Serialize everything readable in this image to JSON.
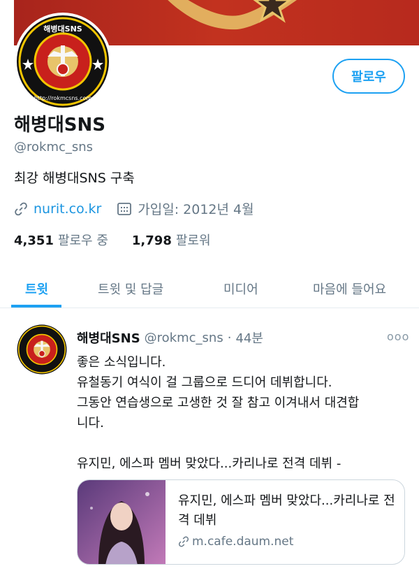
{
  "profile": {
    "name": "해병대SNS",
    "handle": "@rokmc_sns",
    "bio": "최강 해병대SNS 구축",
    "link": "nurit.co.kr",
    "joined": "가입일: 2012년 4월",
    "following_count": "4,351",
    "following_label": "팔로우 중",
    "followers_count": "1,798",
    "followers_label": "팔로워",
    "follow_button": "팔로우",
    "avatar_ring_text": "해병대SNS",
    "avatar_url_text": "http://rokmcsns.com"
  },
  "tabs": [
    {
      "label": "트윗",
      "active": true
    },
    {
      "label": "트윗 및 답글",
      "active": false
    },
    {
      "label": "미디어",
      "active": false
    },
    {
      "label": "마음에 들어요",
      "active": false
    }
  ],
  "tweet": {
    "name": "해병대SNS",
    "handle": "@rokmc_sns",
    "separator": "·",
    "time": "44분",
    "more": "ooo",
    "lines": [
      "좋은 소식입니다.",
      "유철동기 여식이 걸 그룹으로 드디어 데뷔합니다.",
      "그동안 연습생으로 고생한 것 잘 참고 이겨내서 대견합",
      "니다.",
      "",
      "유지민, 에스파 멤버 맞았다...카리나로 전격 데뷔 -"
    ],
    "card": {
      "title": "유지민, 에스파 멤버 맞았다...카리나로 전격 데뷔",
      "domain": "m.cafe.daum.net"
    }
  },
  "colors": {
    "accent": "#1da1f2",
    "banner": "#b72a1e",
    "muted": "#657786",
    "text": "#14171a"
  }
}
